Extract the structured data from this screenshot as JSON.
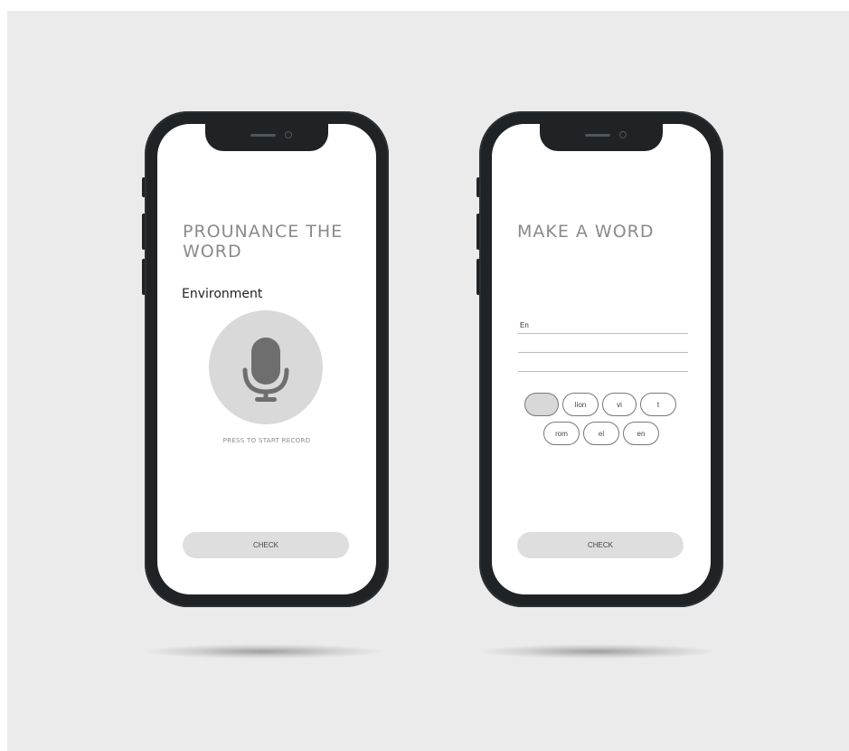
{
  "screens": [
    {
      "title_line1": "PROUNANCE THE",
      "title_line2": "WORD",
      "word": "Environment",
      "mic_icon": "microphone-icon",
      "press_label": "PRESS TO START RECORD",
      "check_label": "CHECK"
    },
    {
      "title": "MAKE A WORD",
      "answer_text": "En",
      "chips": [
        "",
        "lion",
        "vi",
        "t",
        "rom",
        "el",
        "en"
      ],
      "check_label": "CHECK"
    }
  ],
  "colors": {
    "background": "#ebebeb",
    "phone_frame": "#1f2326",
    "title_gray": "#8a8a8a",
    "button_gray": "#dedede",
    "mic_circle": "#d9d9d9",
    "mic_icon": "#6e6e6e"
  }
}
